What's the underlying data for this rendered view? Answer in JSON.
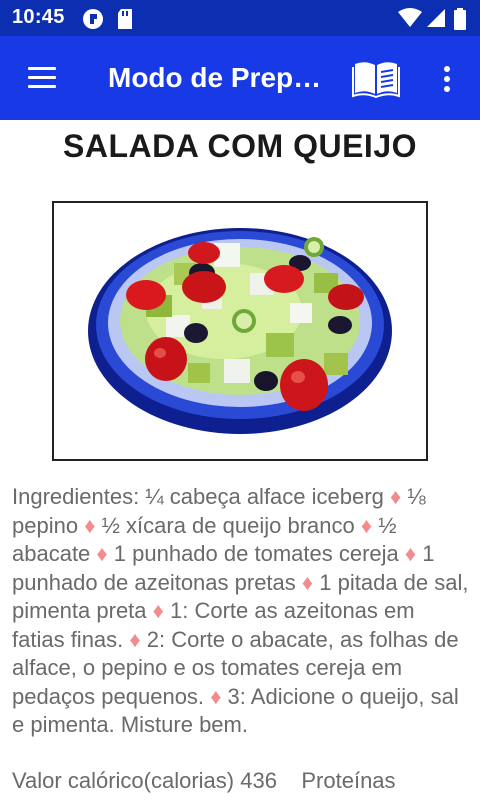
{
  "status_bar": {
    "time": "10:45",
    "icons": [
      "pocket-casts-icon",
      "sd-card-icon",
      "wifi-icon",
      "cellular-signal-icon",
      "battery-icon"
    ]
  },
  "app_bar": {
    "title": "Modo de Prep…",
    "icons": [
      "menu-icon",
      "book-icon",
      "more-vert-icon"
    ],
    "color": "#1739e6"
  },
  "recipe": {
    "title": "SALADA COM QUEIJO",
    "ingredients_label": "Ingredientes: ",
    "items": [
      "¼ cabeça alface iceberg",
      "⅛ pepino",
      "½ xícara de queijo branco",
      "½ abacate",
      "1 punhado de tomates cereja",
      "1 punhado de azeitonas pretas",
      "1 pitada de sal, pimenta preta",
      "1: Corte as azeitonas em fatias finas.",
      "2: Corte o abacate, as folhas de alface, o pepino e os tomates cereja em pedaços pequenos.",
      "3: Adicione o queijo, sal e pimenta. Misture bem."
    ],
    "separator": "♦",
    "nutrition": "Valor calórico(calorias) 436    Proteínas"
  },
  "colors": {
    "status_bar": "#0b2fb0",
    "app_bar": "#1739e6",
    "separator": "#f28b8b",
    "body_text": "#6a6a6a"
  }
}
